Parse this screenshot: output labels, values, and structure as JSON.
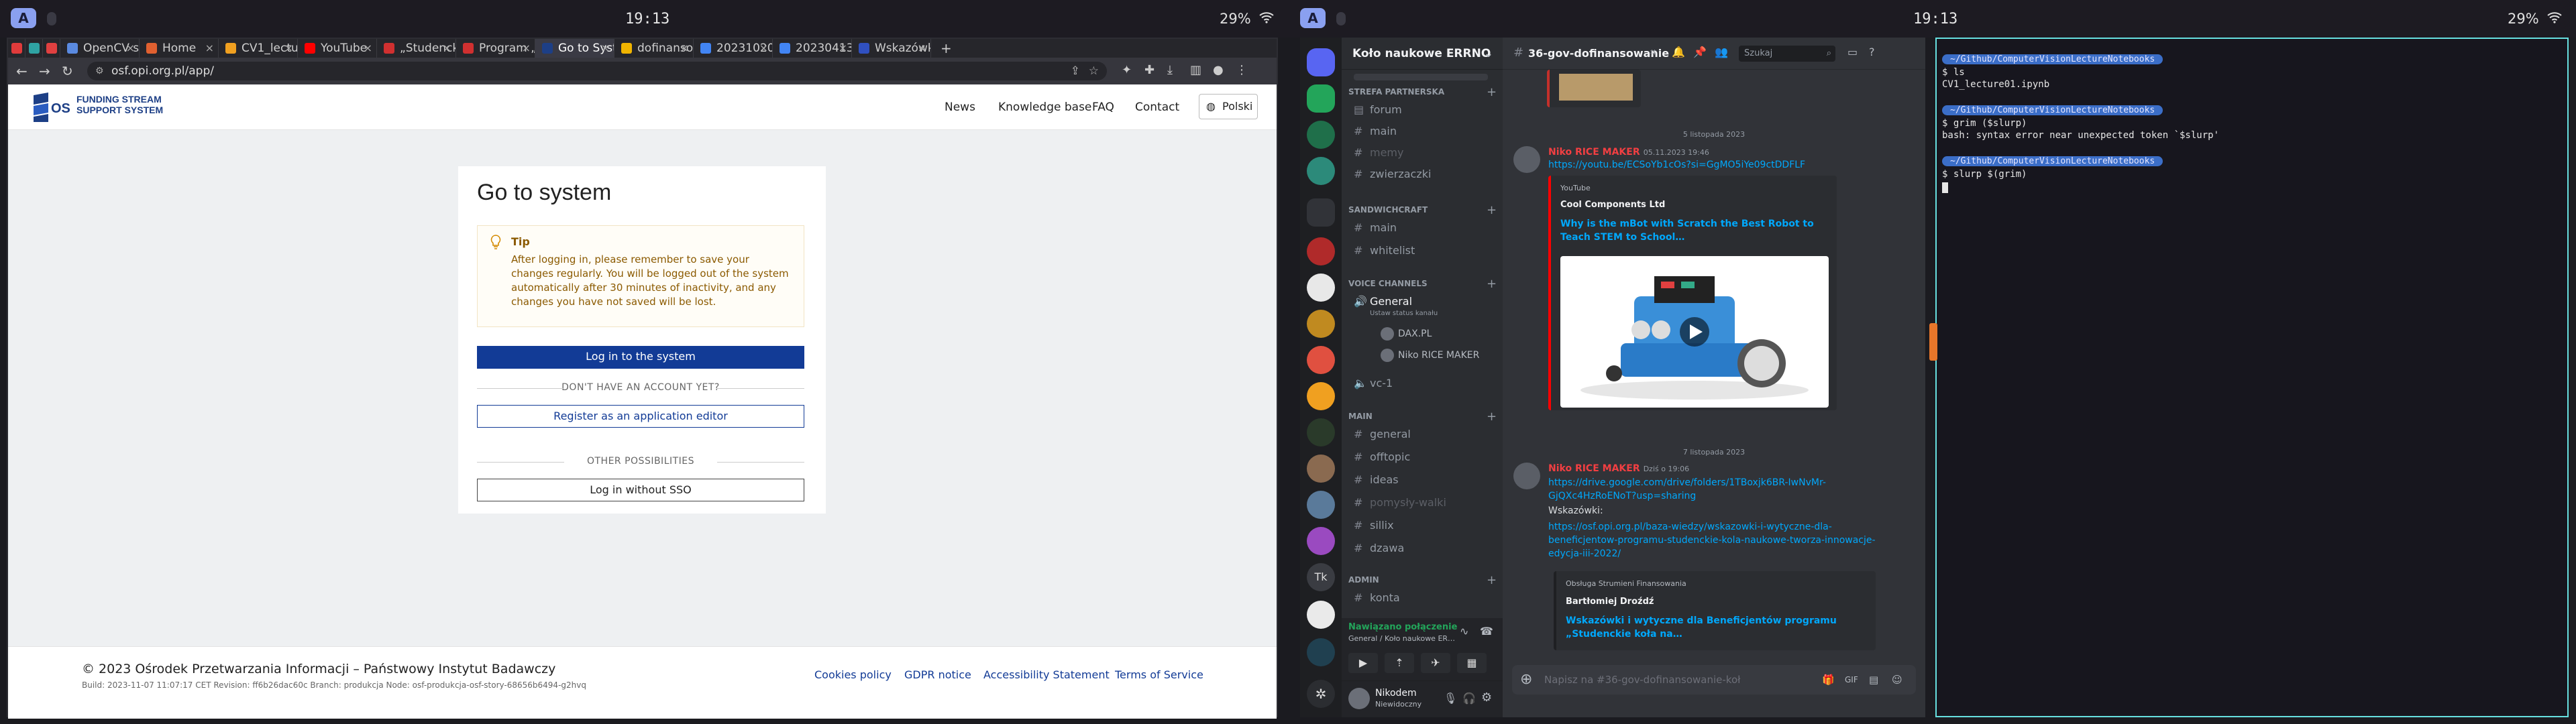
{
  "left_statusbar": {
    "workspace": "A",
    "clock": "19:13",
    "battery": "29%"
  },
  "right_statusbar": {
    "workspace": "A",
    "clock": "19:13",
    "battery": "29%"
  },
  "browser": {
    "tabs": [
      {
        "label": "",
        "color": "#e03b3b"
      },
      {
        "label": "",
        "color": "#2fa3a3"
      },
      {
        "label": "",
        "color": "#e04040"
      },
      {
        "label": "OpenCV sh…",
        "color": "#5a8ae0"
      },
      {
        "label": "Home",
        "color": "#e06030"
      },
      {
        "label": "CV1_lectur…",
        "color": "#f0a020"
      },
      {
        "label": "YouTube",
        "color": "#ff0000"
      },
      {
        "label": "„Studenckie…",
        "color": "#d03030"
      },
      {
        "label": "Program „S…",
        "color": "#d03030"
      },
      {
        "label": "Go to Syste…",
        "color": "#1d3f86"
      },
      {
        "label": "dofinansow…",
        "color": "#f0b400"
      },
      {
        "label": "20231020_…",
        "color": "#4285f4"
      },
      {
        "label": "20230413_…",
        "color": "#4285f4"
      },
      {
        "label": "Wskazówki…",
        "color": "#3050c0"
      }
    ],
    "url": "osf.opi.org.pl/app/",
    "site": {
      "logo_line1": "FUNDING STREAM",
      "logo_line2": "SUPPORT SYSTEM",
      "logo_mark": "OSF",
      "nav": [
        "News",
        "Knowledge base",
        "FAQ",
        "Contact"
      ],
      "language": "Polski",
      "title": "Go to system",
      "tip_title": "Tip",
      "tip_body": "After logging in, please remember to save your changes regularly. You will be logged out of the system automatically after 30 minutes of inactivity, and any changes you have not saved will be lost.",
      "login_button": "Log in to the system",
      "no_account": "DON'T HAVE AN ACCOUNT YET?",
      "register_button": "Register as an application editor",
      "other": "OTHER POSSIBILITIES",
      "nosso_button": "Log in without SSO",
      "footer_copy": "© 2023 Ośrodek Przetwarzania Informacji – Państwowy Instytut Badawczy",
      "footer_build": "Build: 2023-11-07 11:07:17 CET   Revision: ff6b26dac60c   Branch: produkcja   Node: osf-produkcja-osf-story-68656b6494-g2hvq",
      "footer_links": [
        "Cookies policy",
        "GDPR notice",
        "Accessibility Statement",
        "Terms of Service"
      ]
    }
  },
  "discord": {
    "server_name": "Koło naukowe ERRNO",
    "categories": [
      {
        "name": "STREFA PARTNERSKA"
      },
      {
        "name": "SANDWICHCRAFT"
      },
      {
        "name": "VOICE CHANNELS"
      },
      {
        "name": "MAIN"
      },
      {
        "name": "ADMIN"
      }
    ],
    "channels_partner": [
      "forum",
      "main",
      "memy",
      "zwierzaczki"
    ],
    "channels_sandwich": [
      "main",
      "whitelist"
    ],
    "voice_channel": "General",
    "voice_status": "Ustaw status kanału",
    "voice_users": [
      "DAX.PL",
      "Niko RICE MAKER"
    ],
    "voice_other": "vc-1",
    "channels_main": [
      "general",
      "offtopic",
      "ideas",
      "pomysły-walki",
      "sillix",
      "dzawa"
    ],
    "channels_admin": [
      "konta"
    ],
    "voice_connected": "Nawiązano połączenie",
    "voice_connected_sub": "General / Koło naukowe ER…",
    "user_name": "Nikodem",
    "user_status": "Niewidoczny",
    "channel_title": "36-gov-dofinansowanie",
    "search": "Szukaj",
    "date1": "5 listopada 2023",
    "msg1": {
      "author": "Niko RICE MAKER",
      "time": "05.11.2023 19:46",
      "link": "https://youtu.be/ECSoYb1cOs?si=GgMO5iYe09ctDDFLF",
      "embed_provider": "YouTube",
      "embed_author": "Cool Components Ltd",
      "embed_title": "Why is the mBot with Scratch the Best Robot to Teach STEM to School…"
    },
    "date2": "7 listopada 2023",
    "msg2": {
      "author": "Niko RICE MAKER",
      "time": "Dziś o 19:06",
      "link": "https://drive.google.com/drive/folders/1TBoxjk6BR-IwNvMr-GjQXc4HzRoENoT?usp=sharing",
      "label": "Wskazówki:",
      "link2": "https://osf.opi.org.pl/baza-wiedzy/wskazowki-i-wytyczne-dla-beneficjentow-programu-studenckie-kola-naukowe-tworza-innowacje-edycja-iii-2022/",
      "embed_provider": "Obsługa Strumieni Finansowania",
      "embed_author": "Bartłomiej Droźdź",
      "embed_title": "Wskazówki i wytyczne dla Beneficjentów programu „Studenckie koła na…"
    },
    "composer_placeholder": "Napisz na #36-gov-dofinansowanie-koł"
  },
  "terminal": {
    "path": "~/Github/ComputerVisionLectureNotebooks",
    "lines": [
      {
        "prompt": "$ ls",
        "out": "CV1_lecture01.ipynb"
      },
      {
        "prompt": "$ grim ($slurp)",
        "out": "bash: syntax error near unexpected token `$slurp'"
      },
      {
        "prompt": "$ slurp $(grim)",
        "out": ""
      }
    ]
  }
}
